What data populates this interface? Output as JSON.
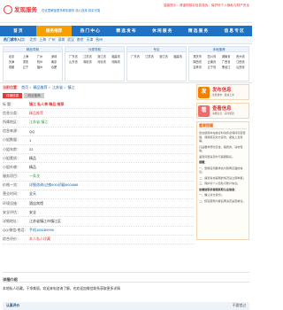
{
  "header": {
    "logo_text": "发现服务",
    "slogan": "在这里解锁更多精彩服务 放心选择 真实可靠",
    "notice": "温馨提示：请谨慎核实信息真伪，保护好个人隐私与财产安全"
  },
  "nav": [
    "首 页",
    "服务推荐",
    "热 门 中 心",
    "精 选 发 布",
    "休 闲 服 务",
    "精 选 服 务",
    "信 息 专 区"
  ],
  "cities": {
    "label": "热门城市入口：",
    "items": [
      "北京",
      "上海",
      "广州",
      "深圳",
      "武汉",
      "南京",
      "天津",
      "杭州"
    ]
  },
  "categories": [
    {
      "title": "精品导航",
      "items": [
        "北京",
        "上海",
        "广州",
        "深圳",
        "天津",
        "重庆",
        "杭州",
        "南京",
        "成都",
        "辽宁",
        "福州",
        "合肥"
      ]
    },
    {
      "title": "分类导航",
      "items": [
        "广东省",
        "江苏省",
        "浙江省",
        "福建省",
        "山东省",
        "湖北省",
        "河北省",
        "河南省"
      ]
    },
    {
      "title": "专区",
      "items": [
        "广东省",
        "江苏省",
        "浙江省",
        "福建省"
      ]
    },
    {
      "title": "本地推荐",
      "items": [
        "重庆市",
        "四川省",
        "湖南省",
        "贵州省",
        "陕西省",
        "云南省",
        "广西省",
        "江西省",
        "吉林省",
        "辽宁省",
        "黑龙江",
        "山西省"
      ]
    }
  ],
  "breadcrumb": {
    "label": "当前位置：",
    "items": [
      "首页",
      "精品推荐",
      "江苏省",
      "镇江"
    ]
  },
  "tabs": [
    "详细信息",
    "附近推荐"
  ],
  "detail_rows": [
    {
      "k": "标 题：",
      "v": "镇江 私人茶 精品 推荐"
    },
    {
      "k": "信息分类：",
      "v": "精品推荐"
    },
    {
      "k": "所属地区：",
      "v": "江苏省-镇江"
    },
    {
      "k": "信息来源：",
      "v": "QQ"
    },
    {
      "k": "小姐数量：",
      "v": "1"
    },
    {
      "k": "小姐年龄：",
      "v": "22"
    },
    {
      "k": "小姐素质：",
      "v": "精品"
    },
    {
      "k": "小姐外貌：",
      "v": "精品"
    },
    {
      "k": "服务项目：",
      "v": "一条龙"
    },
    {
      "k": "价格一览：",
      "v": "详细咨询/过夜600/初级600/888"
    },
    {
      "k": "营业时间：",
      "v": "全天"
    },
    {
      "k": "环境设施：",
      "v": "酒店宾馆"
    },
    {
      "k": "安全评估：",
      "v": "安全"
    },
    {
      "k": "详细地址：",
      "v": "江苏省镇江市镇江区"
    },
    {
      "k": "QQ/微信/电话：",
      "v": "手机165289990"
    },
    {
      "k": "综合评价：",
      "v": "本人私人珍藏"
    }
  ],
  "promos": [
    {
      "title": "发布信息",
      "sub": "免费发布 · 极速上架",
      "icon": "post-icon",
      "icon_text": "发"
    },
    {
      "title": "查看信息",
      "sub": "海量信息 · 实时更新",
      "icon": "view-icon",
      "icon_text": "看"
    }
  ],
  "tipbox": {
    "title": "重要提醒",
    "paras": [
      "您在使用本站信息时请务必保持高度警惕，谨慎核实对方身份，避免上当受骗。",
      "凡是要求预付定金、路费的，请勿轻信。",
      "遇到问题请及时与客服联系。",
      "提醒：",
      "一、警惕任何要求先付款再见面的信息；",
      "二、遇到冒充客服的情况请立即举报；",
      "三、保护好个人隐私与账户信息。",
      "加微信联系客服获取认证信息：",
      "一、确认对方身份；",
      "二、核实服务内容后再决定是否前往。"
    ]
  },
  "section_title": "详细介绍",
  "intro_text": "本地私人珍藏，干净美丽，欢迎来电咨询了解，也欢迎加微信联系获取更多详情",
  "bottombar": {
    "left": "认真评价",
    "right": "不要错过"
  },
  "colors": {
    "nav": "#1f71c4",
    "accent": "#f6a000",
    "red": "#e4393c",
    "link": "#1a5fa0"
  }
}
